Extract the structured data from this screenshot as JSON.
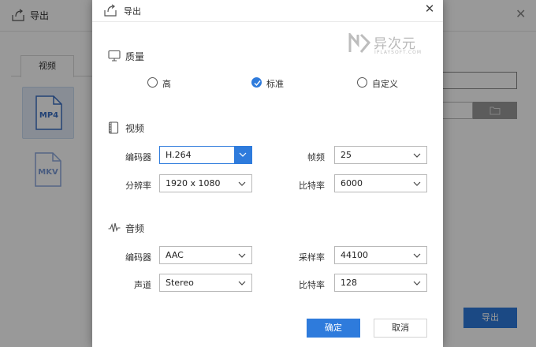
{
  "background": {
    "window_title": "导出",
    "close_glyph": "✕",
    "tab_video": "视频",
    "formats": [
      {
        "label": "MP4",
        "selected": true
      },
      {
        "label": "MKV",
        "selected": false
      }
    ],
    "export_button": "导出"
  },
  "dialog": {
    "title": "导出",
    "close_glyph": "✕",
    "watermark": {
      "text": "异次元",
      "sub": "IPLAYSOFT.COM"
    },
    "quality": {
      "heading": "质量",
      "options": [
        {
          "label": "高",
          "checked": false
        },
        {
          "label": "标准",
          "checked": true
        },
        {
          "label": "自定义",
          "checked": false
        }
      ]
    },
    "video": {
      "heading": "视频",
      "encoder_label": "编码器",
      "encoder_value": "H.264",
      "framerate_label": "帧频",
      "framerate_value": "25",
      "resolution_label": "分辨率",
      "resolution_value": "1920 x 1080",
      "bitrate_label": "比特率",
      "bitrate_value": "6000"
    },
    "audio": {
      "heading": "音频",
      "encoder_label": "编码器",
      "encoder_value": "AAC",
      "samplerate_label": "采样率",
      "samplerate_value": "44100",
      "channel_label": "声道",
      "channel_value": "Stereo",
      "bitrate_label": "比特率",
      "bitrate_value": "128"
    },
    "ok_button": "确定",
    "cancel_button": "取消"
  },
  "colors": {
    "accent": "#2e7bdc",
    "overlay": "rgba(0,0,0,0.40)"
  }
}
